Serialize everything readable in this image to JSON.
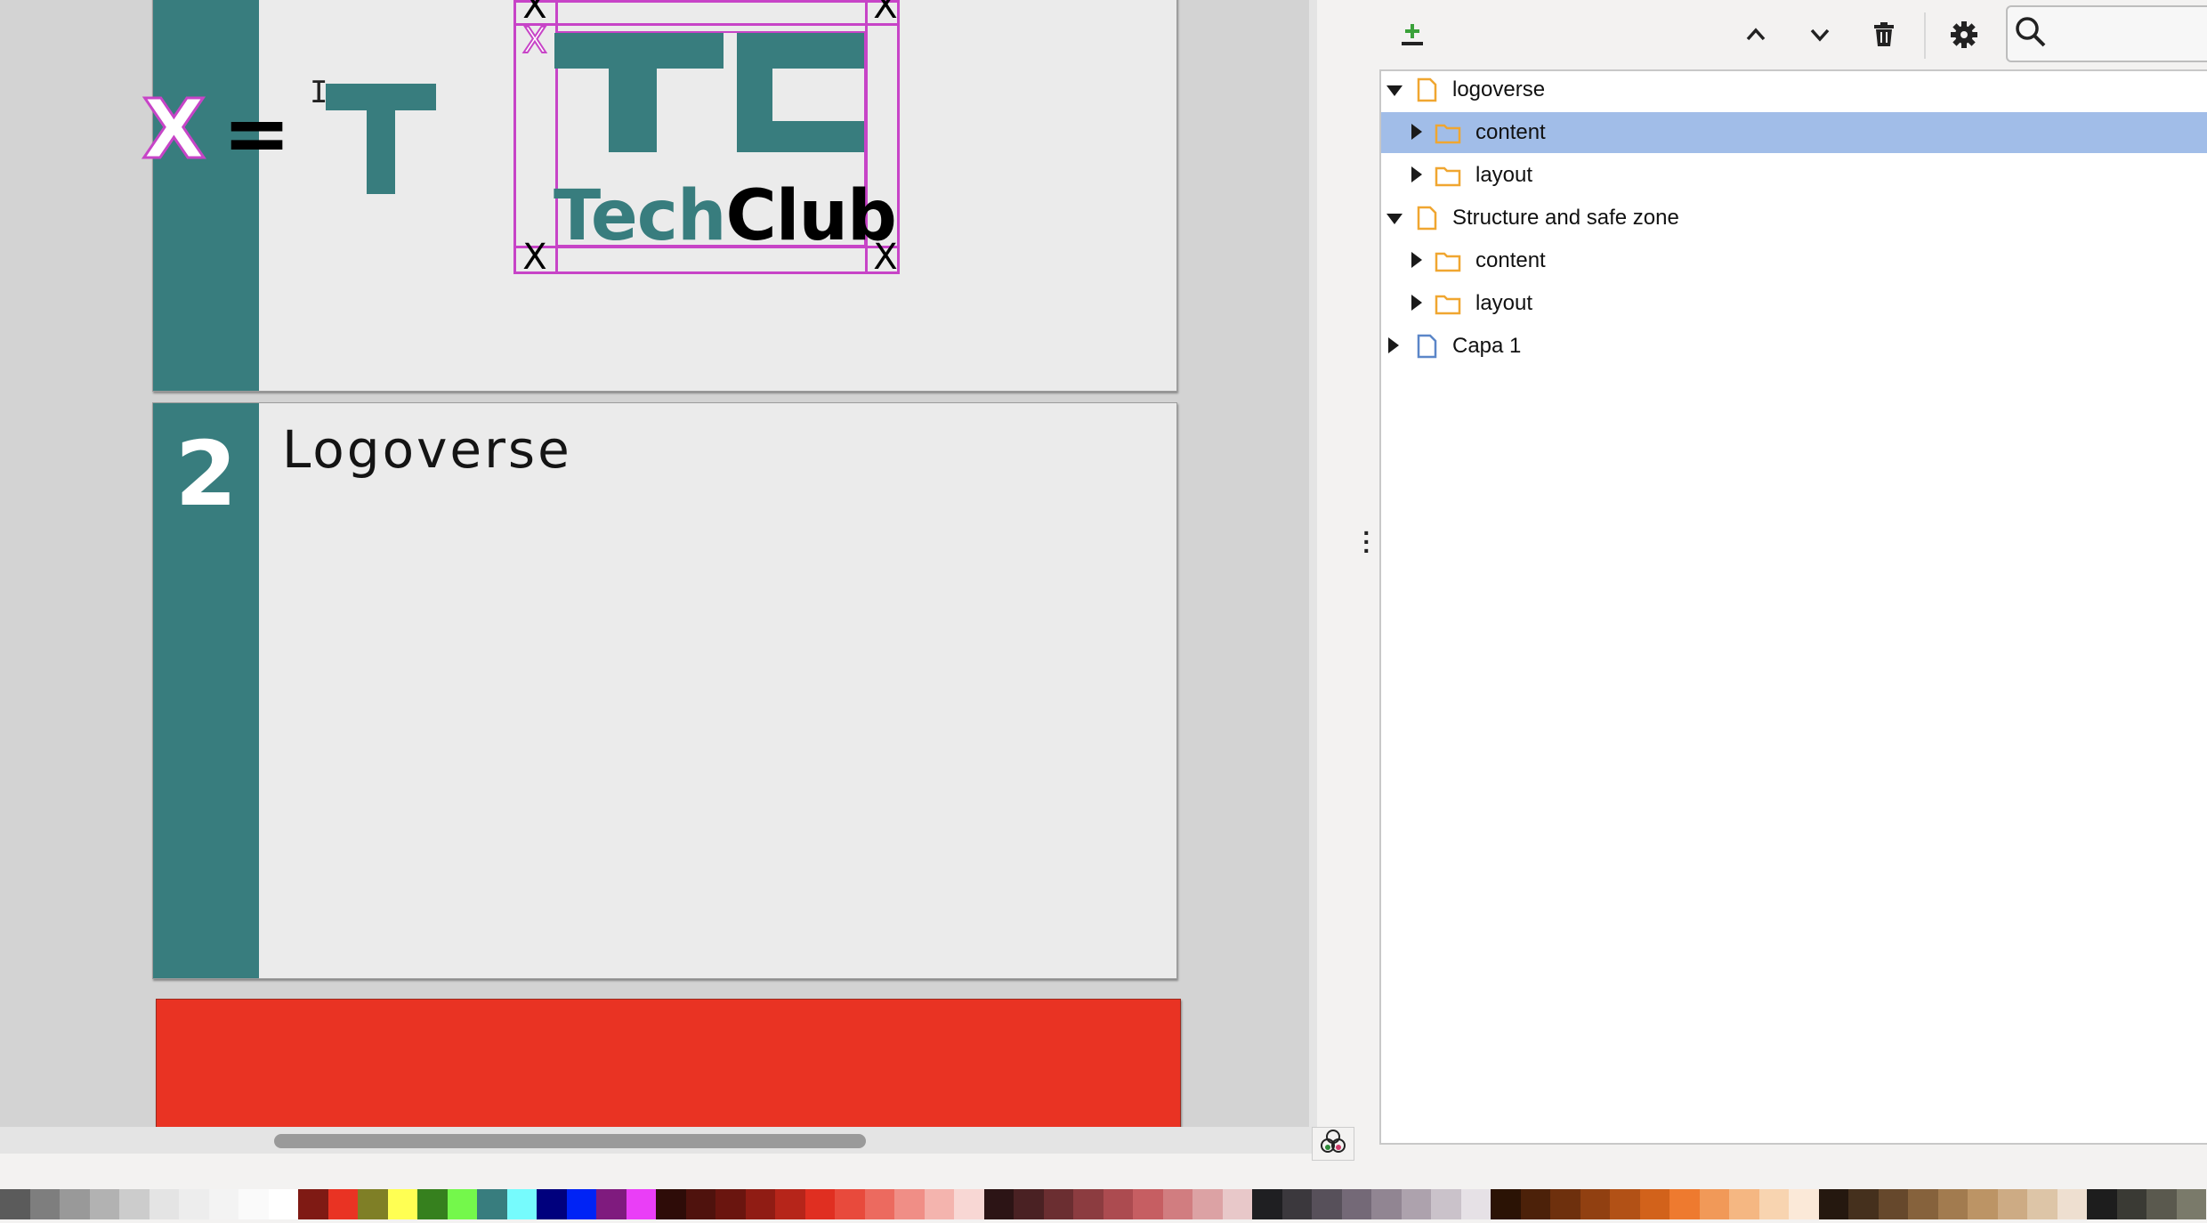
{
  "canvas": {
    "slide2_number": "2",
    "slide2_title": "Logoverse",
    "formula": {
      "x_symbol": "X",
      "equals": "="
    },
    "logo": {
      "word_tech": "Tech",
      "word_club": "Club"
    },
    "guide_marker": "X",
    "colors": {
      "teal": "#387d7e",
      "guide_magenta": "#c744c7",
      "red_block": "#e93323"
    }
  },
  "layers_toolbar": {
    "icons": [
      "add-layer-icon",
      "raise-layer-icon",
      "lower-layer-icon",
      "delete-layer-icon",
      "settings-icon",
      "search-icon"
    ],
    "search_value": ""
  },
  "layers": [
    {
      "label": "logoverse",
      "depth": 0,
      "expanded": true,
      "icon": "layer-page-icon",
      "selected": false
    },
    {
      "label": "content",
      "depth": 1,
      "expanded": false,
      "icon": "folder-icon",
      "selected": true
    },
    {
      "label": "layout",
      "depth": 1,
      "expanded": false,
      "icon": "folder-icon",
      "selected": false
    },
    {
      "label": "Structure and safe zone",
      "depth": 0,
      "expanded": true,
      "icon": "layer-page-icon",
      "selected": false
    },
    {
      "label": "content",
      "depth": 1,
      "expanded": false,
      "icon": "folder-icon",
      "selected": false
    },
    {
      "label": "layout",
      "depth": 1,
      "expanded": false,
      "icon": "folder-icon",
      "selected": false
    },
    {
      "label": "Capa 1",
      "depth": 0,
      "expanded": false,
      "icon": "layer-doc-icon",
      "selected": false
    }
  ],
  "palette": [
    "#5b5b5b",
    "#7e7e7e",
    "#999999",
    "#b2b2b2",
    "#cccccc",
    "#e4e4e4",
    "#ededed",
    "#f3f3f3",
    "#fafafa",
    "#ffffff",
    "#7f1a14",
    "#e93323",
    "#7f7f26",
    "#ffff53",
    "#36801e",
    "#74f84b",
    "#387d7e",
    "#76fbfd",
    "#00007d",
    "#0023f5",
    "#7f1b7e",
    "#ea3ef7",
    "#2e0c08",
    "#4f120d",
    "#6a150f",
    "#901c14",
    "#b6251a",
    "#e02f21",
    "#e84a3c",
    "#ec6a5f",
    "#f08e86",
    "#f4b4ae",
    "#f8d7d4",
    "#2c1415",
    "#4a2123",
    "#6b2e31",
    "#8c3c40",
    "#ac4b50",
    "#c65e62",
    "#d17d80",
    "#dca2a4",
    "#e8c8c9",
    "#1f1f22",
    "#3b383d",
    "#57505a",
    "#746977",
    "#918592",
    "#ada2ad",
    "#cac2ca",
    "#e6e1e6",
    "#2b1305",
    "#4c2109",
    "#6e300d",
    "#914011",
    "#b25116",
    "#d2621b",
    "#ee7a2f",
    "#f19958",
    "#f5b782",
    "#f8d4b0",
    "#fbe9d8",
    "#25180f",
    "#45301d",
    "#66482c",
    "#86623c",
    "#a27b4f",
    "#bc9465",
    "#cdab84",
    "#ddc5a7",
    "#eedfd0",
    "#1d1d1d",
    "#3a3a34",
    "#5a594e",
    "#7a7a6a"
  ]
}
